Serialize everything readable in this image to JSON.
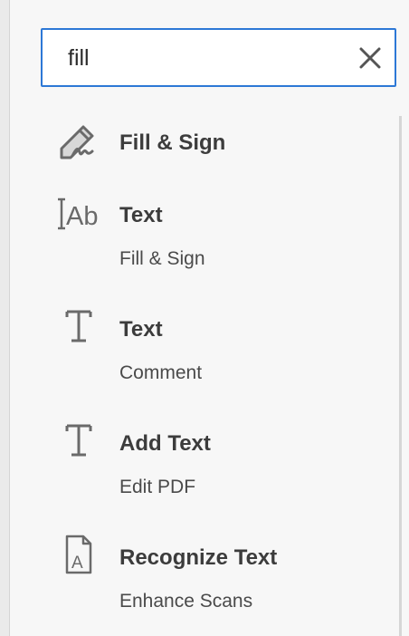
{
  "search": {
    "value": "fill",
    "clear_icon": "close-icon"
  },
  "results": [
    {
      "title": "Fill & Sign",
      "subtitle": "",
      "icon": "fill-sign-pen-icon"
    },
    {
      "title": "Text",
      "subtitle": "Fill & Sign",
      "icon": "text-field-ab-icon"
    },
    {
      "title": "Text",
      "subtitle": "Comment",
      "icon": "text-t-icon"
    },
    {
      "title": "Add Text",
      "subtitle": "Edit PDF",
      "icon": "text-t-icon"
    },
    {
      "title": "Recognize Text",
      "subtitle": "Enhance Scans",
      "icon": "recognize-text-document-icon"
    }
  ]
}
